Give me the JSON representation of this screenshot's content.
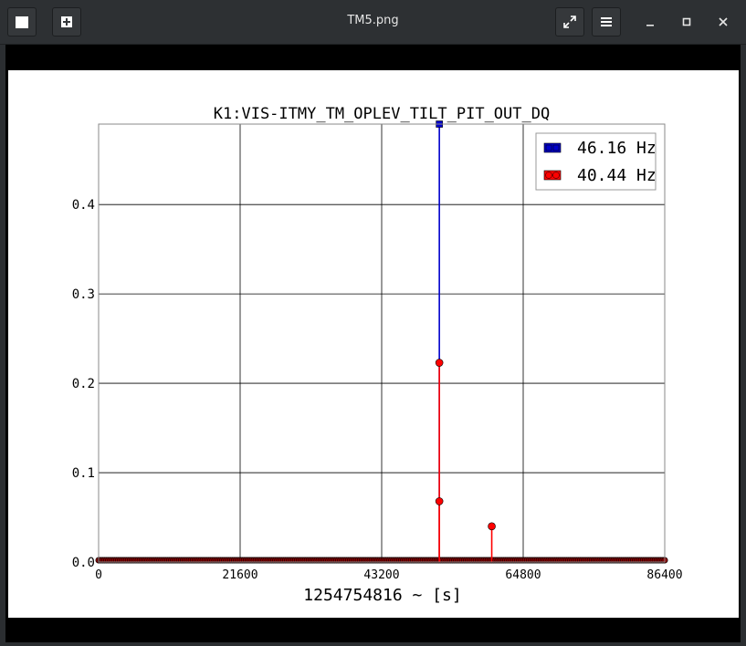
{
  "window": {
    "title": "TM5.png",
    "icons": [
      "window-menu-icon",
      "new-tab-icon",
      "fullscreen-icon",
      "hamburger-menu-icon",
      "minimize-icon",
      "maximize-icon",
      "close-icon"
    ]
  },
  "chart_data": {
    "type": "line",
    "title": "K1:VIS-ITMY_TM_OPLEV_TILT_PIT_OUT_DQ",
    "xlabel": "1254754816 ~ [s]",
    "ylabel": "",
    "xlim": [
      0,
      86400
    ],
    "ylim": [
      0,
      0.49
    ],
    "xticks": [
      0,
      21600,
      43200,
      64800,
      86400
    ],
    "xtick_labels": [
      "0",
      "21600",
      "43200",
      "64800",
      "86400"
    ],
    "yticks": [
      0.0,
      0.1,
      0.2,
      0.3,
      0.4
    ],
    "ytick_labels": [
      "0.0",
      "0.1",
      "0.2",
      "0.3",
      "0.4"
    ],
    "grid": true,
    "legend_position": "top-right",
    "series": [
      {
        "name": "46.16 Hz",
        "color": "#0000cc",
        "marker": "square",
        "x": [
          52000
        ],
        "y": [
          0.49
        ]
      },
      {
        "name": "40.44 Hz",
        "color": "#ff0000",
        "marker": "circle",
        "x": [
          52000,
          52000,
          60000
        ],
        "y": [
          0.223,
          0.068,
          0.04
        ]
      }
    ]
  }
}
